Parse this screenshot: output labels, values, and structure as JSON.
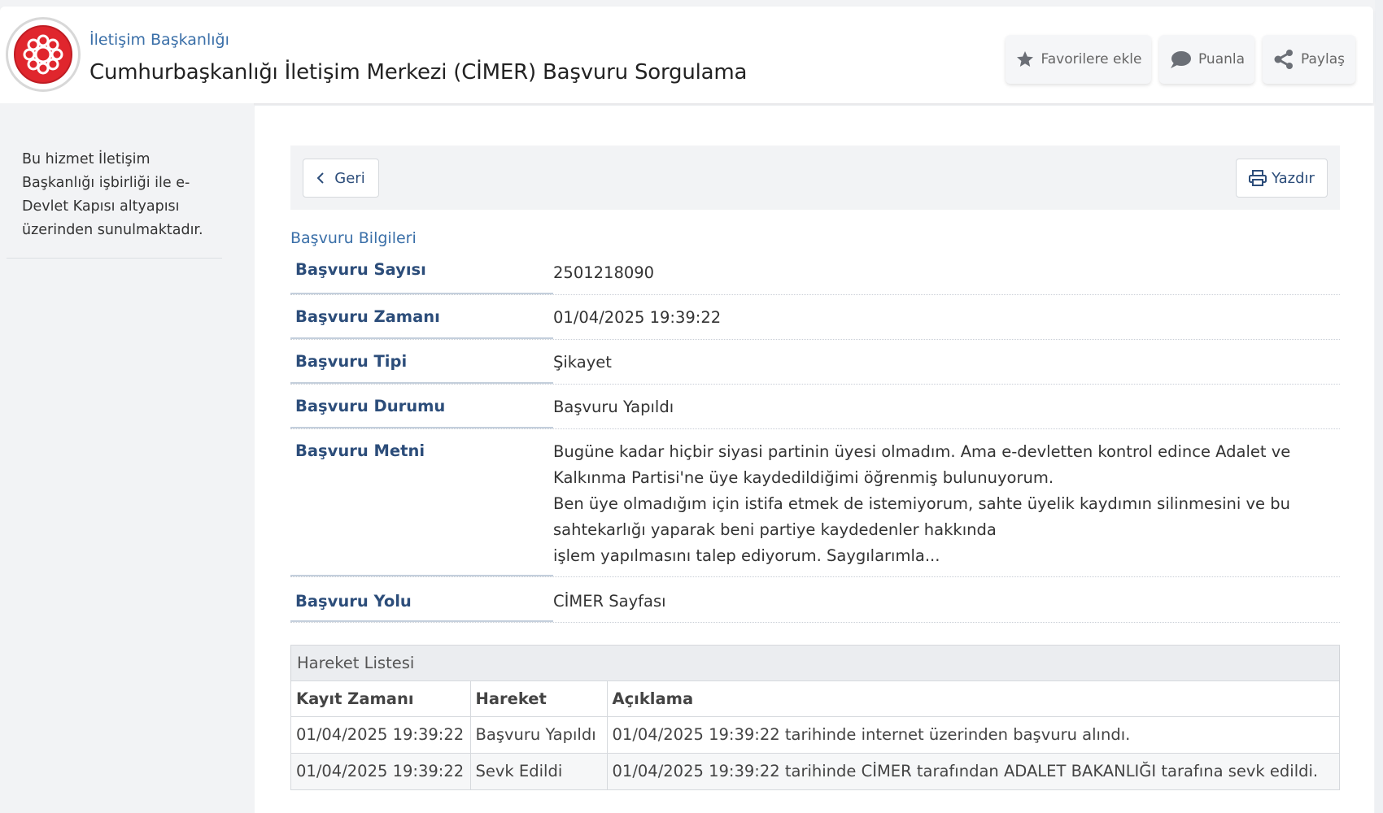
{
  "header": {
    "org_name": "İletişim Başkanlığı",
    "service_title": "Cumhurbaşkanlığı İletişim Merkezi (CİMER) Başvuru Sorgulama",
    "buttons": {
      "favorites": "Favorilere ekle",
      "rate": "Puanla",
      "share": "Paylaş"
    }
  },
  "sidebar": {
    "text": "Bu hizmet İletişim Başkanlığı işbirliği ile e-Devlet Kapısı altyapısı üzerinden sunulmaktadır."
  },
  "toolbar": {
    "back_label": "Geri",
    "print_label": "Yazdır"
  },
  "application": {
    "section_title": "Başvuru Bilgileri",
    "rows": [
      {
        "label": "Başvuru Sayısı",
        "value": "2501218090"
      },
      {
        "label": "Başvuru Zamanı",
        "value": "01/04/2025 19:39:22"
      },
      {
        "label": "Başvuru Tipi",
        "value": "Şikayet"
      },
      {
        "label": "Başvuru Durumu",
        "value": "Başvuru Yapıldı"
      },
      {
        "label": "Başvuru Metni",
        "lines": [
          "Bugüne kadar hiçbir siyasi partinin üyesi olmadım. Ama e-devletten kontrol edince Adalet ve",
          "Kalkınma Partisi'ne üye kaydedildiğimi öğrenmiş bulunuyorum.",
          "Ben üye olmadığım için istifa etmek de istemiyorum, sahte üyelik kaydımın silinmesini ve bu",
          "sahtekarlığı yaparak beni partiye kaydedenler hakkında",
          "işlem yapılmasını talep ediyorum. Saygılarımla..."
        ]
      },
      {
        "label": "Başvuru Yolu",
        "value": "CİMER Sayfası"
      }
    ]
  },
  "movements": {
    "title": "Hareket Listesi",
    "columns": [
      "Kayıt Zamanı",
      "Hareket",
      "Açıklama"
    ],
    "rows": [
      [
        "01/04/2025 19:39:22",
        "Başvuru Yapıldı",
        "01/04/2025 19:39:22 tarihinde internet üzerinden başvuru alındı."
      ],
      [
        "01/04/2025 19:39:22",
        "Sevk Edildi",
        "01/04/2025 19:39:22 tarihinde CİMER tarafından ADALET BAKANLIĞI tarafına sevk edildi."
      ]
    ]
  },
  "colors": {
    "accent_blue": "#3a6fa8",
    "label_blue": "#2c4d7a",
    "logo_red": "#e0262d"
  },
  "icons": {
    "favorites": "star-icon",
    "rate": "speech-bubble-icon",
    "share": "share-icon",
    "back": "chevron-left-icon",
    "print": "printer-icon"
  }
}
